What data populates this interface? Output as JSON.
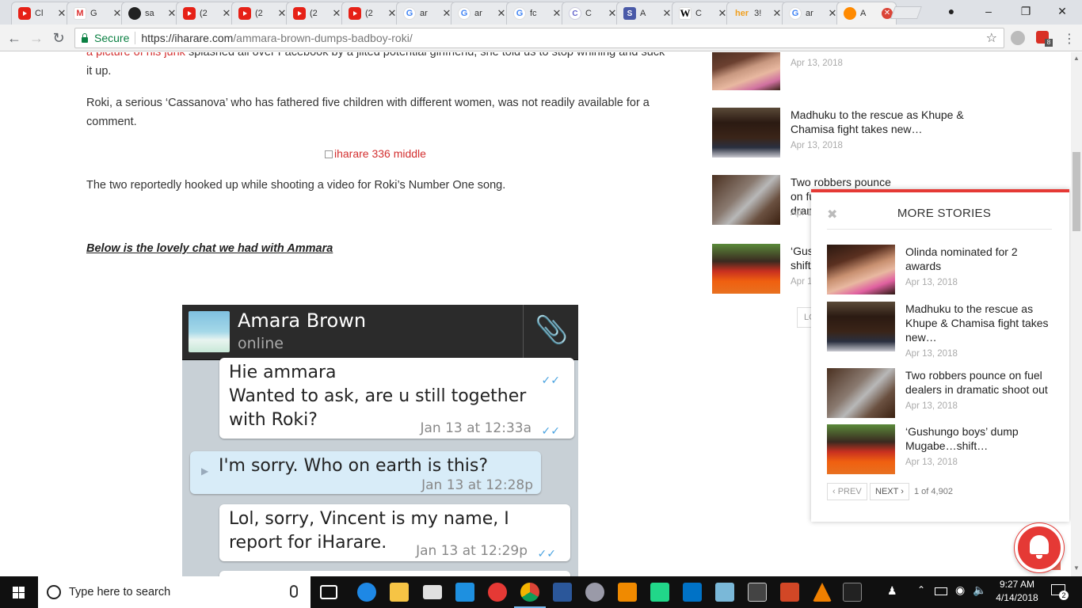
{
  "browser": {
    "tabs": [
      {
        "icon": "youtube-icon",
        "label": "Cl",
        "fav": "yt"
      },
      {
        "icon": "gmail-icon",
        "label": "G",
        "fav": "gm",
        "glyph": "M"
      },
      {
        "icon": "github-icon",
        "label": "sa",
        "fav": "gh"
      },
      {
        "icon": "youtube-icon",
        "label": "(2",
        "fav": "yt"
      },
      {
        "icon": "youtube-icon",
        "label": "(2",
        "fav": "yt"
      },
      {
        "icon": "youtube-icon",
        "label": "(2",
        "fav": "yt"
      },
      {
        "icon": "youtube-icon",
        "label": "(2",
        "fav": "yt"
      },
      {
        "icon": "google-icon",
        "label": "ar",
        "fav": "g",
        "glyph": "G"
      },
      {
        "icon": "google-icon",
        "label": "ar",
        "fav": "g",
        "glyph": "G"
      },
      {
        "icon": "google-icon",
        "label": "fc",
        "fav": "g",
        "glyph": "G"
      },
      {
        "icon": "semaphore-icon",
        "label": "C",
        "fav": "sem",
        "glyph": "C"
      },
      {
        "icon": "s-icon",
        "label": "A",
        "fav": "s",
        "glyph": "S"
      },
      {
        "icon": "wikipedia-icon",
        "label": "C",
        "fav": "w",
        "glyph": "W"
      },
      {
        "icon": "her-icon",
        "label": "3!",
        "fav": "her",
        "glyph": "her"
      },
      {
        "icon": "google-icon",
        "label": "ar",
        "fav": "g",
        "glyph": "G"
      },
      {
        "icon": "fire-icon",
        "label": "A",
        "fav": "fire",
        "active": true
      }
    ],
    "url": {
      "secure_label": "Secure",
      "host": "https://iharare.com",
      "path": "/ammara-brown-dumps-badboy-roki/"
    },
    "extension_badge": "8"
  },
  "article": {
    "para1_link": "a picture of his junk",
    "para1_rest": " splashed all over Facebook by a jilted potential girlfriend, she told us to stop whining and suck it up.",
    "para2": "Roki, a serious ‘Cassanova’ who has fathered five children with different women, was not readily available for a comment.",
    "ad_alt": "iharare 336 middle",
    "para3": "The two reportedly hooked up while shooting a video for Roki’s Number One song.",
    "chat_heading": "Below is the lovely chat we had with Ammara"
  },
  "chat": {
    "contact_name": "Amara Brown",
    "status": "online",
    "messages": [
      {
        "line1": "Hie ammara",
        "line2": "Wanted to ask, are u still together",
        "line3": "with Roki?",
        "time": "Jan 13 at 12:33a"
      },
      {
        "line1": "I'm sorry.  Who on earth is this?",
        "time": "Jan 13 at 12:28p"
      },
      {
        "line1": "Lol, sorry, Vincent is my name, I",
        "line2": "report for iHarare.",
        "time": "Jan 13 at 12:29p"
      }
    ]
  },
  "sidebar": {
    "items": [
      {
        "title": "",
        "date": "Apr 13, 2018"
      },
      {
        "title": "Madhuku to the rescue as Khupe & Chamisa fight takes new…",
        "date": "Apr 13, 2018"
      },
      {
        "title": "Two robbers pounce on fuel dealers in dran",
        "date": "Apr 1"
      },
      {
        "title": "‘Gus shift",
        "date": "Apr 1"
      }
    ],
    "load_more": "LO"
  },
  "more_stories": {
    "title": "MORE STORIES",
    "items": [
      {
        "title": "Olinda nominated for 2 awards",
        "date": "Apr 13, 2018"
      },
      {
        "title": "Madhuku to the rescue as Khupe & Chamisa fight takes new…",
        "date": "Apr 13, 2018"
      },
      {
        "title": "Two robbers pounce on fuel dealers in dramatic shoot out",
        "date": "Apr 13, 2018"
      },
      {
        "title": "‘Gushungo boys’ dump Mugabe…shift…",
        "date": "Apr 13, 2018"
      }
    ],
    "prev_label": "‹ PREV",
    "next_label": "NEXT ›",
    "page_info": "1 of 4,902"
  },
  "taskbar": {
    "search_placeholder": "Type here to search",
    "time": "9:27 AM",
    "date": "4/14/2018",
    "notification_count": "2"
  }
}
